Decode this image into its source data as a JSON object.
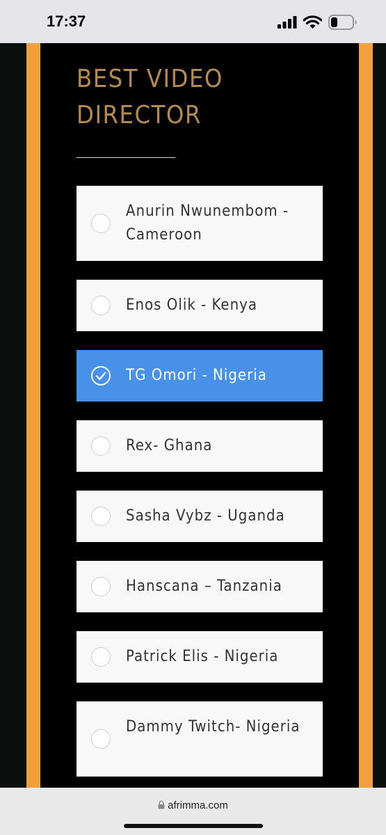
{
  "status_bar": {
    "time": "17:37",
    "icons": [
      "signal-icon",
      "wifi-icon",
      "battery-icon"
    ]
  },
  "page": {
    "title": "BEST VIDEO DIRECTOR",
    "options": [
      {
        "label": "Anurin Nwunembom - Cameroon",
        "selected": false
      },
      {
        "label": "Enos Olik - Kenya",
        "selected": false
      },
      {
        "label": "TG Omori - Nigeria",
        "selected": true
      },
      {
        "label": "Rex- Ghana",
        "selected": false
      },
      {
        "label": "Sasha Vybz - Uganda",
        "selected": false
      },
      {
        "label": "Hanscana – Tanzania",
        "selected": false
      },
      {
        "label": "Patrick Elis - Nigeria",
        "selected": false
      },
      {
        "label": "Dammy Twitch- Nigeria",
        "selected": false
      }
    ]
  },
  "browser": {
    "url": "afrimma.com",
    "lock_icon": "lock-icon"
  },
  "colors": {
    "accent_orange": "#f0a03d",
    "title_gold": "#b58a4e",
    "selected_blue": "#4891e8"
  }
}
